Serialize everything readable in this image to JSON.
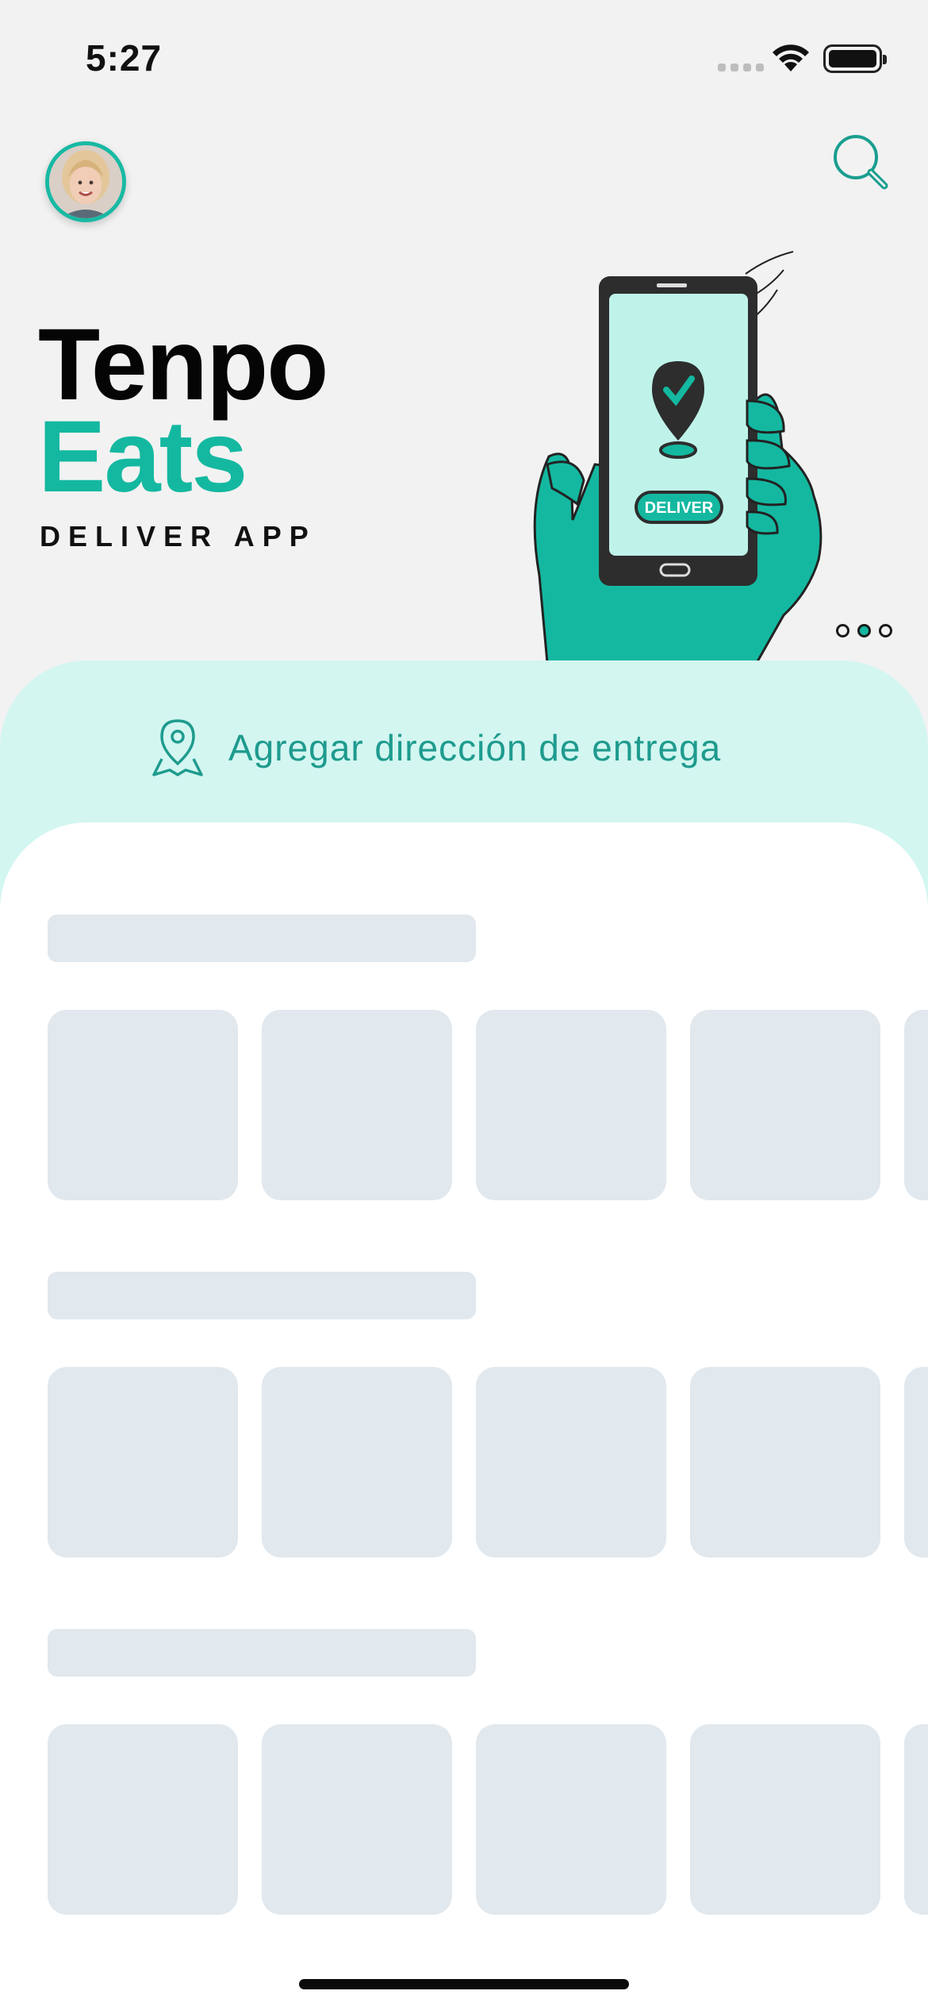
{
  "status_bar": {
    "time": "5:27"
  },
  "header": {
    "avatar_alt": "user-avatar",
    "search_icon": "search-icon"
  },
  "brand": {
    "line1": "Tenpo",
    "line2": "Eats",
    "subtitle": "DELIVER APP"
  },
  "hero": {
    "button_label": "DELIVER"
  },
  "carousel": {
    "pages": 3,
    "active_index": 1
  },
  "address": {
    "label": "Agregar dirección de entrega",
    "icon": "location-pin-icon"
  },
  "colors": {
    "accent": "#14b8a0",
    "accent_light": "#d3f6f1",
    "skeleton": "#e1e8ee",
    "background": "#f2f2f2"
  }
}
